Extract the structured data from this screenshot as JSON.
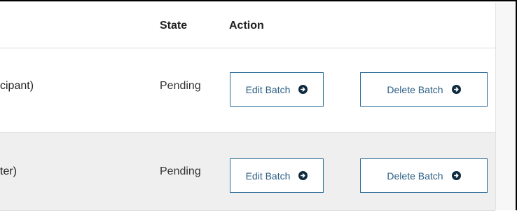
{
  "table": {
    "headers": {
      "state": "State",
      "action": "Action"
    },
    "rows": [
      {
        "name_fragment": "cipant)",
        "state": "Pending",
        "edit_label": "Edit Batch",
        "delete_label": "Delete Batch"
      },
      {
        "name_fragment": "ter)",
        "state": "Pending",
        "edit_label": "Edit Batch",
        "delete_label": "Delete Batch"
      }
    ]
  },
  "icons": {
    "button_icon": "arrow-right-circle-icon"
  },
  "colors": {
    "button_border": "#2b6b98",
    "button_text": "#2b5f85",
    "icon_fill": "#0e2a3f",
    "alt_row_bg": "#efefef"
  }
}
